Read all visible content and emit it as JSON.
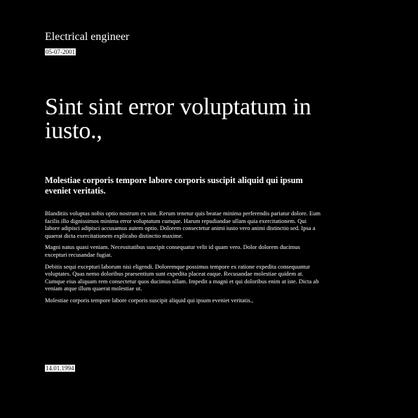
{
  "header": {
    "occupation": "Electrical engineer",
    "date": "05-07-2001"
  },
  "article": {
    "headline": "Sint sint error voluptatum in iusto.,",
    "subheadline": "Molestiae corporis tempore labore corporis suscipit aliquid qui ipsum eveniet veritatis.",
    "paragraphs": [
      "Blanditiis voluptas nobis optio nostrum ex sint. Rerum tenetur quis beatae minima perferendis pariatur dolore. Eum facilis illo dignissimos minima error voluptatum cumque. Harum repudiandae ullam quia exercitationem. Qui labore adipisci adipisci accusamus autem optio. Dolorem consectetur animi iusto vero animi distinctio sed. Ipsa a quaerat dicta exercitationem explicabo distinctio maxime.",
      "Magni natus quasi veniam. Necessitatibus suscipit consequatur velit id quam vero. Dolor dolorem ducimus excepturi recusandae fugiat.",
      "Debitis sequi excepturi laborum nisi eligendi. Doloremque possimus tempore ex ratione expedita consequuntur voluptates. Quas nemo doloribus praesentium sunt expedita placeat eaque. Recusandae molestiae quidem at. Cumque eius aliquam rem consectetur quos ducimus ullam. Impedit a magni et qui doloribus enim at iste. Dicta ab veniam atque illum quaerat molestiae ut.",
      "Molestiae corporis tempore labore corporis suscipit aliquid qui ipsum eveniet veritatis.,"
    ]
  },
  "footer": {
    "date": "14.01.1994"
  }
}
